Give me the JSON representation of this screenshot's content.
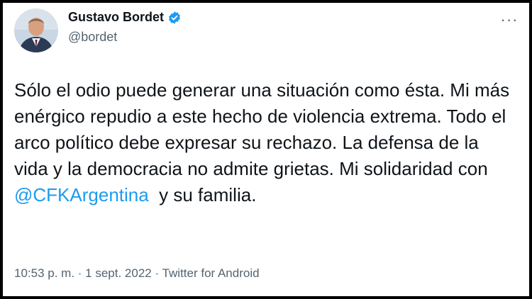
{
  "author": {
    "name": "Gustavo Bordet",
    "handle": "@bordet",
    "avatar_icon": "profile-photo"
  },
  "tweet": {
    "text_before": "Sólo el odio puede generar una situación como ésta. Mi más enérgico repudio a este hecho de violencia extrema. Todo el arco político debe expresar su rechazo. La defensa de la vida y la democracia no admite grietas. Mi solidaridad con",
    "mention": "@CFKArgentina",
    "text_after": "  y su familia."
  },
  "meta": {
    "time": "10:53 p. m.",
    "date": "1 sept. 2022",
    "source": "Twitter for Android",
    "separator": " · "
  },
  "colors": {
    "link": "#1d9bf0",
    "verified": "#1d9bf0",
    "text": "#0f1419",
    "secondary": "#536471"
  },
  "icons": {
    "more": "more-options-icon",
    "verified": "verified-badge-icon"
  }
}
